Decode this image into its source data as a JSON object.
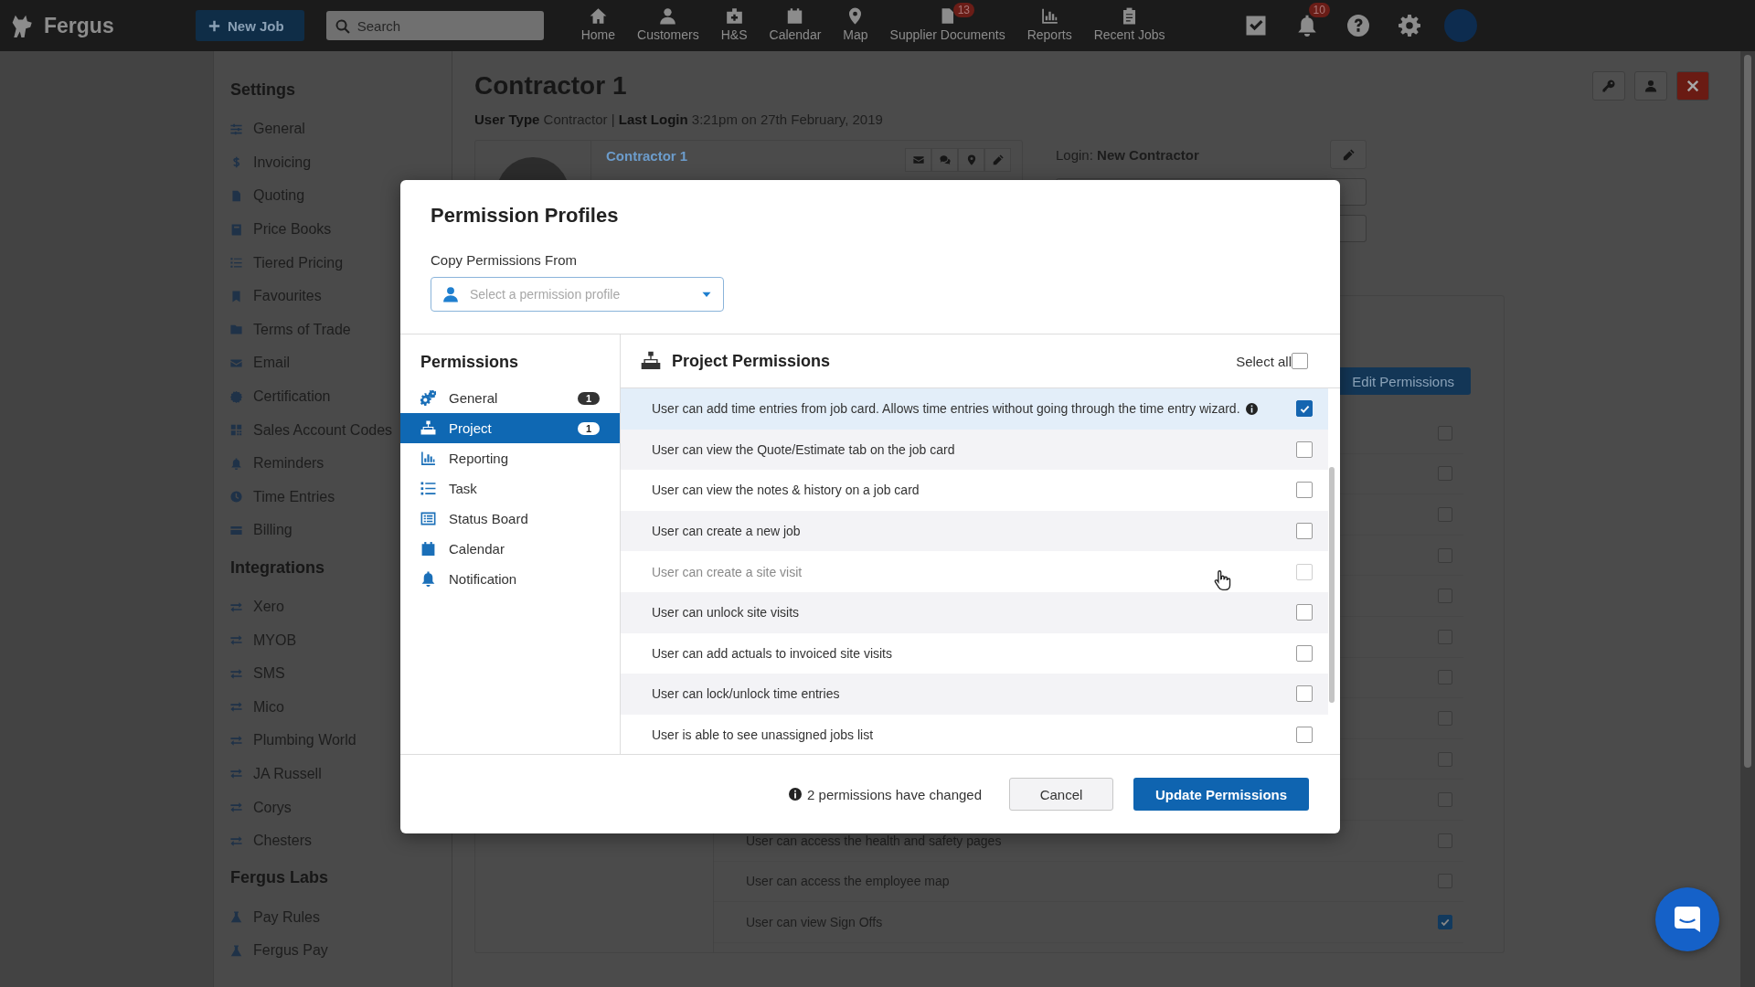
{
  "nav": {
    "logo": "Fergus",
    "new_job": "New Job",
    "search_placeholder": "Search",
    "items": [
      {
        "label": "Home"
      },
      {
        "label": "Customers"
      },
      {
        "label": "H&S"
      },
      {
        "label": "Calendar"
      },
      {
        "label": "Map"
      },
      {
        "label": "Supplier Documents",
        "badge": "13"
      },
      {
        "label": "Reports"
      },
      {
        "label": "Recent Jobs"
      }
    ],
    "notification_badge": "10"
  },
  "sidebar": {
    "sections": [
      {
        "title": "Settings",
        "items": [
          {
            "label": "General"
          },
          {
            "label": "Invoicing"
          },
          {
            "label": "Quoting"
          },
          {
            "label": "Price Books"
          },
          {
            "label": "Tiered Pricing"
          },
          {
            "label": "Favourites"
          },
          {
            "label": "Terms of Trade"
          },
          {
            "label": "Email"
          },
          {
            "label": "Certification"
          },
          {
            "label": "Sales Account Codes"
          },
          {
            "label": "Reminders"
          },
          {
            "label": "Time Entries"
          },
          {
            "label": "Billing"
          }
        ]
      },
      {
        "title": "Integrations",
        "items": [
          {
            "label": "Xero"
          },
          {
            "label": "MYOB"
          },
          {
            "label": "SMS"
          },
          {
            "label": "Mico"
          },
          {
            "label": "Plumbing World"
          },
          {
            "label": "JA Russell"
          },
          {
            "label": "Corys"
          },
          {
            "label": "Chesters"
          }
        ]
      },
      {
        "title": "Fergus Labs",
        "items": [
          {
            "label": "Pay Rules"
          },
          {
            "label": "Fergus Pay"
          }
        ]
      }
    ]
  },
  "main": {
    "title": "Contractor 1",
    "meta": "**User Type** Contractor | **Last Login** 3:21pm on 27th February, 2019",
    "contact_name": "Contractor 1",
    "login": "Login: **New Contractor**",
    "edit_button": "Edit Permissions",
    "permissions": [
      {
        "checked": false
      },
      {
        "checked": false
      },
      {
        "checked": false
      },
      {
        "checked": false
      },
      {
        "checked": false
      },
      {
        "checked": false
      },
      {
        "checked": false
      },
      {
        "checked": false
      },
      {
        "checked": false
      },
      {
        "checked": false
      },
      {
        "label": "User can access the health and safety pages",
        "checked": false
      },
      {
        "label": "User can access the employee map",
        "checked": false
      },
      {
        "label": "User can view Sign Offs",
        "checked": true
      }
    ]
  },
  "modal": {
    "title": "Permission Profiles",
    "copy_label": "Copy Permissions From",
    "select_placeholder": "Select a permission profile",
    "categories_title": "Permissions",
    "categories": [
      {
        "label": "General",
        "badge": "1",
        "selected": false
      },
      {
        "label": "Project",
        "badge": "1",
        "selected": true
      },
      {
        "label": "Reporting",
        "selected": false
      },
      {
        "label": "Task",
        "selected": false
      },
      {
        "label": "Status Board",
        "selected": false
      },
      {
        "label": "Calendar",
        "selected": false
      },
      {
        "label": "Notification",
        "selected": false
      }
    ],
    "section_title": "Project Permissions",
    "select_all": "Select all",
    "select_all_checked": false,
    "permissions": [
      {
        "label": "User can add time entries from job card. Allows time entries without going through the time entry wizard.",
        "info": true,
        "checked": true,
        "disabled": false
      },
      {
        "label": "User can view the Quote/Estimate tab on the job card",
        "checked": false,
        "disabled": false
      },
      {
        "label": "User can view the notes & history on a job card",
        "checked": false,
        "disabled": false
      },
      {
        "label": "User can create a new job",
        "checked": false,
        "disabled": false
      },
      {
        "label": "User can create a site visit",
        "checked": false,
        "disabled": true
      },
      {
        "label": "User can unlock site visits",
        "checked": false,
        "disabled": false
      },
      {
        "label": "User can add actuals to invoiced site visits",
        "checked": false,
        "disabled": false
      },
      {
        "label": "User can lock/unlock time entries",
        "checked": false,
        "disabled": false
      },
      {
        "label": "User is able to see unassigned jobs list",
        "checked": false,
        "disabled": false
      }
    ],
    "notice": "2 permissions have changed",
    "cancel": "Cancel",
    "submit": "Update Permissions"
  }
}
